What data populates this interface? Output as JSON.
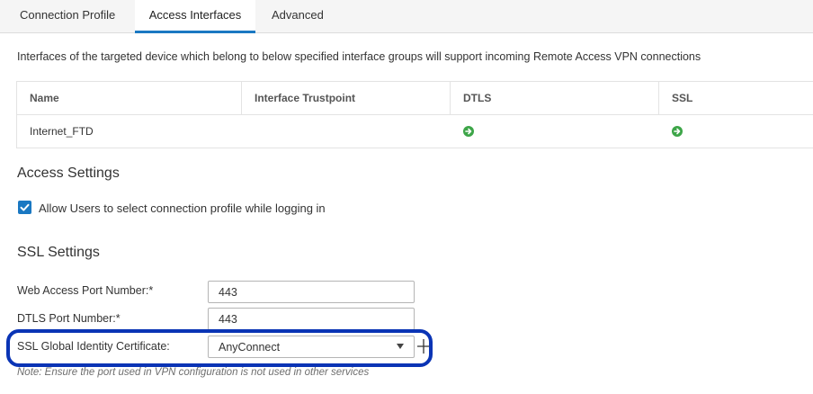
{
  "tabs": [
    {
      "label": "Connection Profile"
    },
    {
      "label": "Access Interfaces"
    },
    {
      "label": "Advanced"
    }
  ],
  "active_tab": "Access Interfaces",
  "description": "Interfaces of the targeted device which belong to below specified interface groups will support incoming Remote Access VPN connections",
  "interfaces_table": {
    "columns": [
      "Name",
      "Interface Trustpoint",
      "DTLS",
      "SSL"
    ],
    "rows": [
      {
        "name": "Internet_FTD",
        "trustpoint": "",
        "dtls_icon": "green-status-arrow-icon",
        "ssl_icon": "green-status-arrow-icon"
      }
    ]
  },
  "access_settings": {
    "title": "Access Settings",
    "allow_select_profile": {
      "label": "Allow Users to select connection profile while logging in",
      "checked": true
    }
  },
  "ssl_settings": {
    "title": "SSL Settings",
    "web_access_port": {
      "label": "Web Access Port Number:*",
      "value": "443"
    },
    "dtls_port": {
      "label": "DTLS Port Number:*",
      "value": "443"
    },
    "certificate": {
      "label": "SSL Global Identity Certificate:",
      "value": "AnyConnect"
    },
    "note": "Note: Ensure the port used in VPN configuration is not used in other services"
  },
  "colors": {
    "accent": "#1a78c2",
    "status_green": "#3da548",
    "annotation_blue": "#0a34b5"
  }
}
